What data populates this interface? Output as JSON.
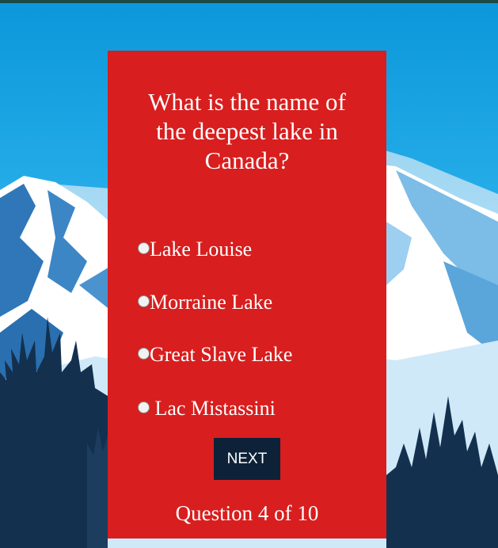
{
  "quiz": {
    "question": "What is the name of the deepest lake in Canada?",
    "options": [
      {
        "label": "Lake Louise"
      },
      {
        "label": "Morraine Lake"
      },
      {
        "label": "Great Slave Lake"
      },
      {
        "label": " Lac Mistassini"
      }
    ],
    "next_label": "NEXT",
    "progress_text": "Question 4 of 10"
  },
  "colors": {
    "card": "#d81e1e",
    "button": "#0d2238",
    "sky": "#0ea2e0",
    "snow": "#ffffff",
    "mountain_shadow": "#2f77b8",
    "trees": "#13314f"
  }
}
